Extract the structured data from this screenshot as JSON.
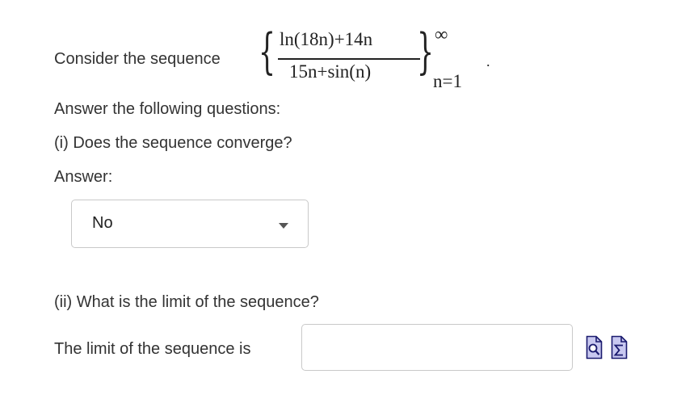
{
  "question": {
    "intro": "Consider the sequence",
    "sequence": {
      "numerator": "ln(18n)+14n",
      "denominator": "15n+sin(n)",
      "upper": "∞",
      "lower": "n=1",
      "trailing_dot": "."
    },
    "instructions": "Answer the following questions:",
    "part1": {
      "prompt": "(i) Does the sequence converge?",
      "answer_label": "Answer:",
      "selected": "No"
    },
    "part2": {
      "prompt": "(ii) What is the limit of the sequence?",
      "limit_label": "The limit of the sequence is",
      "input_value": ""
    }
  },
  "icons": {
    "preview": "preview-answer-icon",
    "equation_editor": "equation-editor-icon"
  },
  "colors": {
    "text": "#333333",
    "border": "#c9c9c9",
    "icon_fill": "#c8c8f0",
    "icon_stroke": "#1a1a6e"
  }
}
